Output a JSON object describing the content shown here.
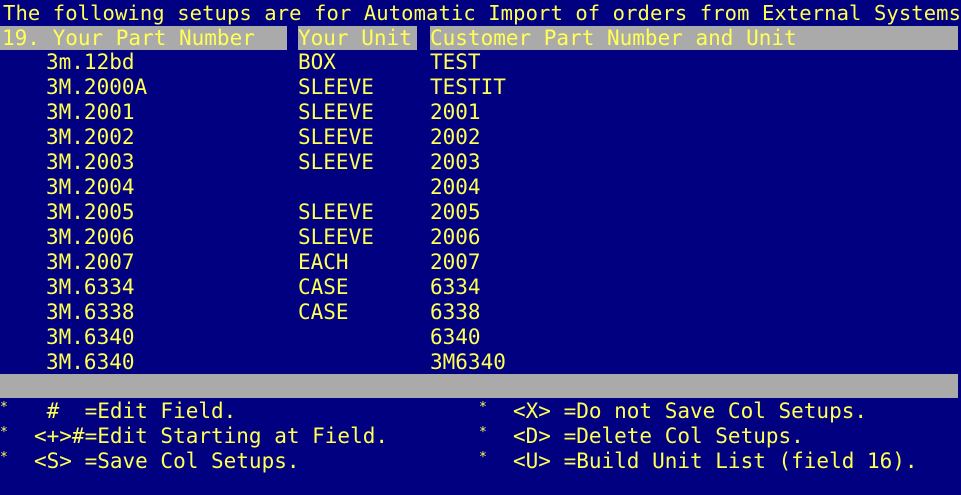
{
  "title": "The following setups are for Automatic Import of orders from External Systems.",
  "columns": {
    "part": "19. Your Part Number",
    "unit": "Your Unit",
    "customer": "Customer Part Number and Unit"
  },
  "rows": [
    {
      "part": "3m.12bd",
      "unit": "BOX",
      "customer": "TEST"
    },
    {
      "part": "3M.2000A",
      "unit": "SLEEVE",
      "customer": "TESTIT"
    },
    {
      "part": "3M.2001",
      "unit": "SLEEVE",
      "customer": "2001"
    },
    {
      "part": "3M.2002",
      "unit": "SLEEVE",
      "customer": "2002"
    },
    {
      "part": "3M.2003",
      "unit": "SLEEVE",
      "customer": "2003"
    },
    {
      "part": "3M.2004",
      "unit": "",
      "customer": "2004"
    },
    {
      "part": "3M.2005",
      "unit": "SLEEVE",
      "customer": "2005"
    },
    {
      "part": "3M.2006",
      "unit": "SLEEVE",
      "customer": "2006"
    },
    {
      "part": "3M.2007",
      "unit": "EACH",
      "customer": "2007"
    },
    {
      "part": "3M.6334",
      "unit": "CASE",
      "customer": "6334"
    },
    {
      "part": "3M.6338",
      "unit": "CASE",
      "customer": "6338"
    },
    {
      "part": "3M.6340",
      "unit": "",
      "customer": "6340"
    },
    {
      "part": "3M.6340",
      "unit": "",
      "customer": "3M6340"
    }
  ],
  "help": {
    "left": [
      {
        "marker": "*",
        "text": " #  =Edit Field."
      },
      {
        "marker": "*",
        "text": "<+>#=Edit Starting at Field."
      },
      {
        "marker": "*",
        "text": "<S> =Save Col Setups."
      }
    ],
    "right": [
      {
        "marker": "*",
        "text": "<X> =Do not Save Col Setups."
      },
      {
        "marker": "*",
        "text": "<D> =Delete Col Setups."
      },
      {
        "marker": "*",
        "text": "<U> =Build Unit List (field 16)."
      }
    ]
  },
  "colors": {
    "background": "#000080",
    "text": "#ffff55",
    "highlight": "#aaaaaa"
  }
}
